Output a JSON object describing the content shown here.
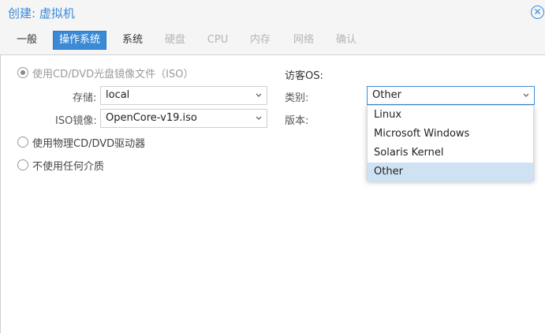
{
  "window": {
    "title": "创建: 虚拟机",
    "close_icon": "close-circle-icon"
  },
  "tabs": [
    {
      "label": "一般",
      "state": "normal"
    },
    {
      "label": "操作系统",
      "state": "active"
    },
    {
      "label": "系统",
      "state": "normal"
    },
    {
      "label": "硬盘",
      "state": "disabled"
    },
    {
      "label": "CPU",
      "state": "disabled"
    },
    {
      "label": "内存",
      "state": "disabled"
    },
    {
      "label": "网络",
      "state": "disabled"
    },
    {
      "label": "确认",
      "state": "disabled"
    }
  ],
  "media": {
    "option_iso": "使用CD/DVD光盘镜像文件（ISO）",
    "storage_label": "存储:",
    "storage_value": "local",
    "iso_label": "ISO镜像:",
    "iso_value": "OpenCore-v19.iso",
    "option_physical": "使用物理CD/DVD驱动器",
    "option_none": "不使用任何介质",
    "selected": "iso"
  },
  "guest_os": {
    "section_title": "访客OS:",
    "type_label": "类别:",
    "type_value": "Other",
    "version_label": "版本:",
    "dropdown_open": true,
    "options": [
      "Linux",
      "Microsoft Windows",
      "Solaris Kernel",
      "Other"
    ],
    "selected_option": "Other"
  },
  "colors": {
    "accent": "#3a8ad6",
    "selected_option_bg": "#cfe2f3",
    "disabled_text": "#b5b5b5"
  }
}
